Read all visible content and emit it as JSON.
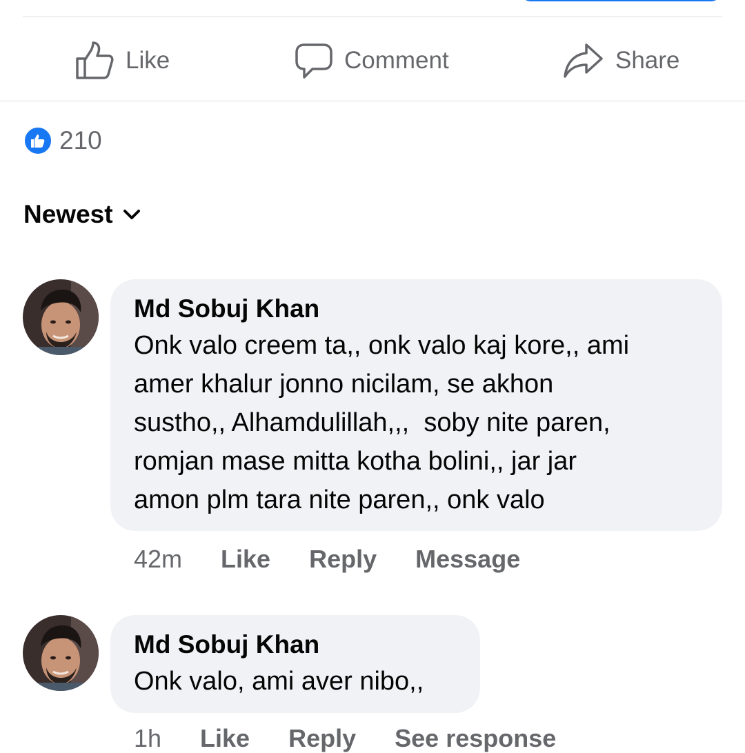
{
  "actions": {
    "like_label": "Like",
    "comment_label": "Comment",
    "share_label": "Share"
  },
  "reactions": {
    "count": "210",
    "icon": "like-badge-icon"
  },
  "sort": {
    "label": "Newest"
  },
  "colors": {
    "accent": "#1877f2",
    "muted": "#65676b",
    "bubble": "#f0f2f5"
  },
  "comments": [
    {
      "author": "Md Sobuj Khan",
      "lines": [
        "Onk valo creem ta,, onk valo kaj kore,, ami",
        "amer khalur jonno nicilam, se akhon",
        "sustho,, Alhamdulillah,,,  soby nite paren,",
        "romjan mase mitta kotha bolini,, jar jar",
        "amon plm tara nite paren,, onk valo"
      ],
      "time": "42m",
      "like": "Like",
      "reply": "Reply",
      "extra": "Message"
    },
    {
      "author": "Md Sobuj Khan",
      "lines": [
        "Onk valo, ami aver nibo,,"
      ],
      "time": "1h",
      "like": "Like",
      "reply": "Reply",
      "extra": "See response"
    }
  ]
}
